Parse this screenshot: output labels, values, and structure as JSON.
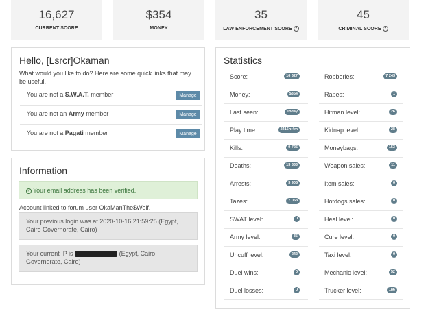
{
  "top_stats": [
    {
      "value": "16,627",
      "label": "CURRENT SCORE",
      "help": false
    },
    {
      "value": "$354",
      "label": "MONEY",
      "help": false
    },
    {
      "value": "35",
      "label": "LAW ENFORCEMENT SCORE",
      "help": true
    },
    {
      "value": "45",
      "label": "CRIMINAL SCORE",
      "help": true
    }
  ],
  "hello": {
    "title": "Hello, [Lsrcr]Okaman",
    "intro": "What would you like to do? Here are some quick links that may be useful.",
    "memberships": [
      {
        "pre": "You are not a ",
        "group": "S.W.A.T.",
        "post": " member",
        "button": "Manage"
      },
      {
        "pre": "You are not an ",
        "group": "Army",
        "post": " member",
        "button": "Manage"
      },
      {
        "pre": "You are not a ",
        "group": "Pagati",
        "post": " member",
        "button": "Manage"
      }
    ]
  },
  "information": {
    "title": "Information",
    "verified": "Your email address has been verified.",
    "forum_link": "Account linked to forum user OkaManThe$Wolf.",
    "previous_login": "Your previous login was at 2020-10-16 21:59:25 (Egypt, Cairo Governorate, Cairo)",
    "current_ip_pre": "Your current IP is",
    "current_ip_post": "(Egypt, Cairo Governorate, Cairo)"
  },
  "statistics": {
    "title": "Statistics",
    "left": [
      {
        "label": "Score:",
        "value": "16 627"
      },
      {
        "label": "Money:",
        "value": "$354"
      },
      {
        "label": "Last seen:",
        "value": "Today"
      },
      {
        "label": "Play time:",
        "value": "2416h:4m"
      },
      {
        "label": "Kills:",
        "value": "9 725"
      },
      {
        "label": "Deaths:",
        "value": "13 333"
      },
      {
        "label": "Arrests:",
        "value": "3 905"
      },
      {
        "label": "Tazes:",
        "value": "7 053"
      },
      {
        "label": "SWAT level:",
        "value": "0"
      },
      {
        "label": "Army level:",
        "value": "35"
      },
      {
        "label": "Uncuff level:",
        "value": "242"
      },
      {
        "label": "Duel wins:",
        "value": "0"
      },
      {
        "label": "Duel losses:",
        "value": "0"
      }
    ],
    "right": [
      {
        "label": "Robberies:",
        "value": "7 243"
      },
      {
        "label": "Rapes:",
        "value": "1"
      },
      {
        "label": "Hitman level:",
        "value": "26"
      },
      {
        "label": "Kidnap level:",
        "value": "28"
      },
      {
        "label": "Moneybags:",
        "value": "153"
      },
      {
        "label": "Weapon sales:",
        "value": "11"
      },
      {
        "label": "Item sales:",
        "value": "0"
      },
      {
        "label": "Hotdogs sales:",
        "value": "0"
      },
      {
        "label": "Heal level:",
        "value": "0"
      },
      {
        "label": "Cure level:",
        "value": "0"
      },
      {
        "label": "Taxi level:",
        "value": "0"
      },
      {
        "label": "Mechanic level:",
        "value": "52"
      },
      {
        "label": "Trucker level:",
        "value": "186"
      }
    ]
  },
  "colors": {
    "badge": "#607d8b",
    "button": "#5d8aa8",
    "success_bg": "#dff0d8",
    "success_text": "#3c763d"
  }
}
